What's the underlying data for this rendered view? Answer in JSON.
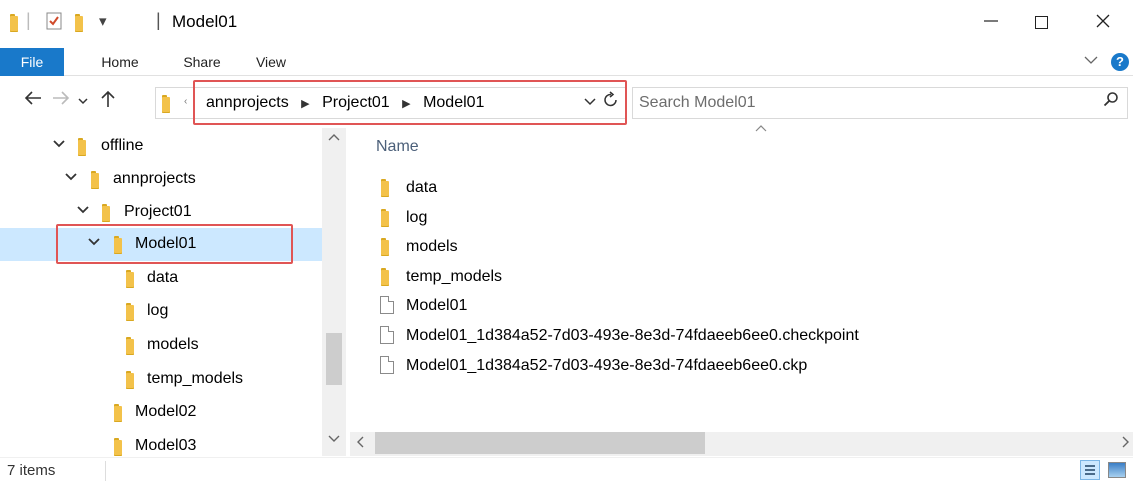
{
  "window": {
    "title": "Model01",
    "qat_dropdown": "▾"
  },
  "ribbon": {
    "tabs": [
      {
        "label": "File"
      },
      {
        "label": "Home"
      },
      {
        "label": "Share"
      },
      {
        "label": "View"
      }
    ],
    "help": "?"
  },
  "address_bar": {
    "crumbs": [
      "annprojects",
      "Project01",
      "Model01"
    ],
    "separator": "▶"
  },
  "search": {
    "placeholder": "Search Model01"
  },
  "nav_tree": {
    "items": [
      {
        "label": "offline"
      },
      {
        "label": "annprojects"
      },
      {
        "label": "Project01"
      },
      {
        "label": "Model01"
      },
      {
        "label": "data"
      },
      {
        "label": "log"
      },
      {
        "label": "models"
      },
      {
        "label": "temp_models"
      },
      {
        "label": "Model02"
      },
      {
        "label": "Model03"
      }
    ]
  },
  "content": {
    "column_header": "Name",
    "rows": [
      {
        "name": "data",
        "type": "folder"
      },
      {
        "name": "log",
        "type": "folder"
      },
      {
        "name": "models",
        "type": "folder"
      },
      {
        "name": "temp_models",
        "type": "folder"
      },
      {
        "name": "Model01",
        "type": "file"
      },
      {
        "name": "Model01_1d384a52-7d03-493e-8e3d-74fdaeeb6ee0.checkpoint",
        "type": "file"
      },
      {
        "name": "Model01_1d384a52-7d03-493e-8e3d-74fdaeeb6ee0.ckp",
        "type": "file"
      }
    ]
  },
  "status": {
    "item_count": "7 items"
  },
  "colors": {
    "accent": "#1979ca",
    "selection": "#cce8ff",
    "highlight_box": "#e05555",
    "folder": "#f3c24a"
  }
}
